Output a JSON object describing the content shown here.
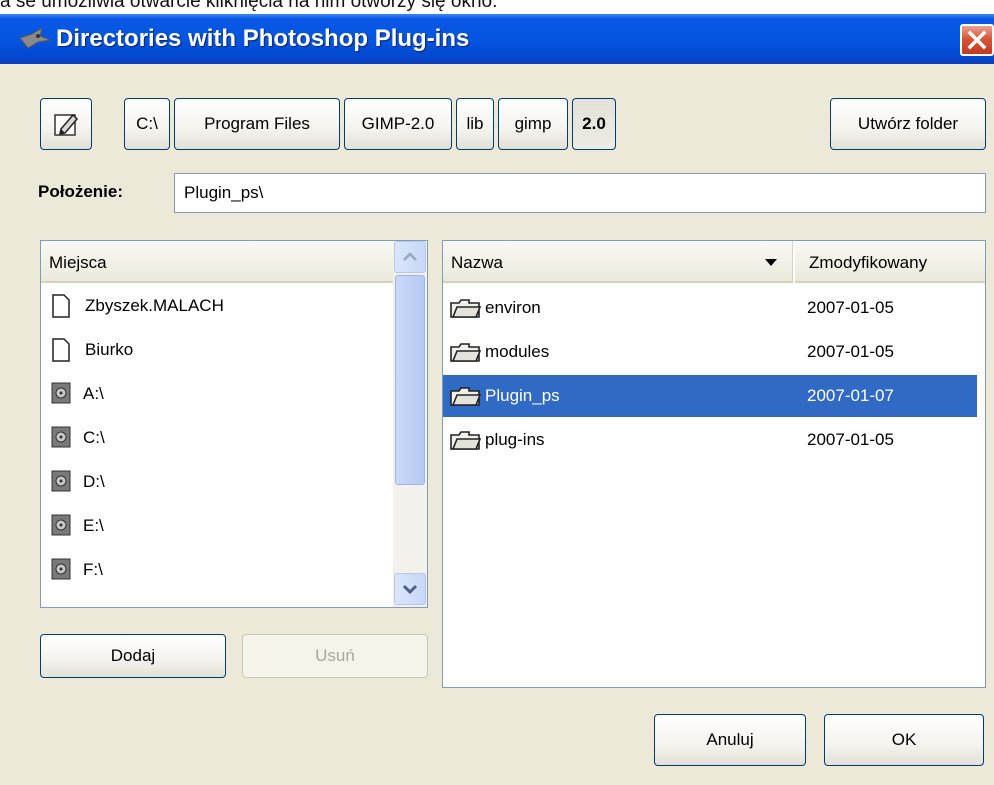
{
  "top_caption": "a se umożliwia otwarcie kliknięcia na nim otworzy się okno.",
  "window": {
    "title": "Directories with Photoshop Plug-ins"
  },
  "path_bar": {
    "segments": [
      "C:\\",
      "Program Files",
      "GIMP-2.0",
      "lib",
      "gimp",
      "2.0"
    ],
    "create_folder_label": "Utwórz folder"
  },
  "location": {
    "label": "Położenie:",
    "value": "Plugin_ps\\"
  },
  "places": {
    "header": "Miejsca",
    "items": [
      {
        "label": "Zbyszek.MALACH",
        "icon": "document-icon"
      },
      {
        "label": "Biurko",
        "icon": "document-icon"
      },
      {
        "label": "A:\\",
        "icon": "drive-icon"
      },
      {
        "label": "C:\\",
        "icon": "drive-icon"
      },
      {
        "label": "D:\\",
        "icon": "drive-icon"
      },
      {
        "label": "E:\\",
        "icon": "drive-icon"
      },
      {
        "label": "F:\\",
        "icon": "drive-icon"
      }
    ],
    "add_label": "Dodaj",
    "remove_label": "Usuń"
  },
  "files": {
    "col_name": "Nazwa",
    "col_modified": "Zmodyfikowany",
    "rows": [
      {
        "name": "environ",
        "modified": "2007-01-05"
      },
      {
        "name": "modules",
        "modified": "2007-01-05"
      },
      {
        "name": "Plugin_ps",
        "modified": "2007-01-07",
        "selected": true
      },
      {
        "name": "plug-ins",
        "modified": "2007-01-05"
      }
    ]
  },
  "buttons": {
    "cancel": "Anuluj",
    "ok": "OK"
  },
  "colors": {
    "selection": "#316ac5",
    "title_bar": "#0555e0",
    "dialog_bg": "#ece9d8"
  }
}
